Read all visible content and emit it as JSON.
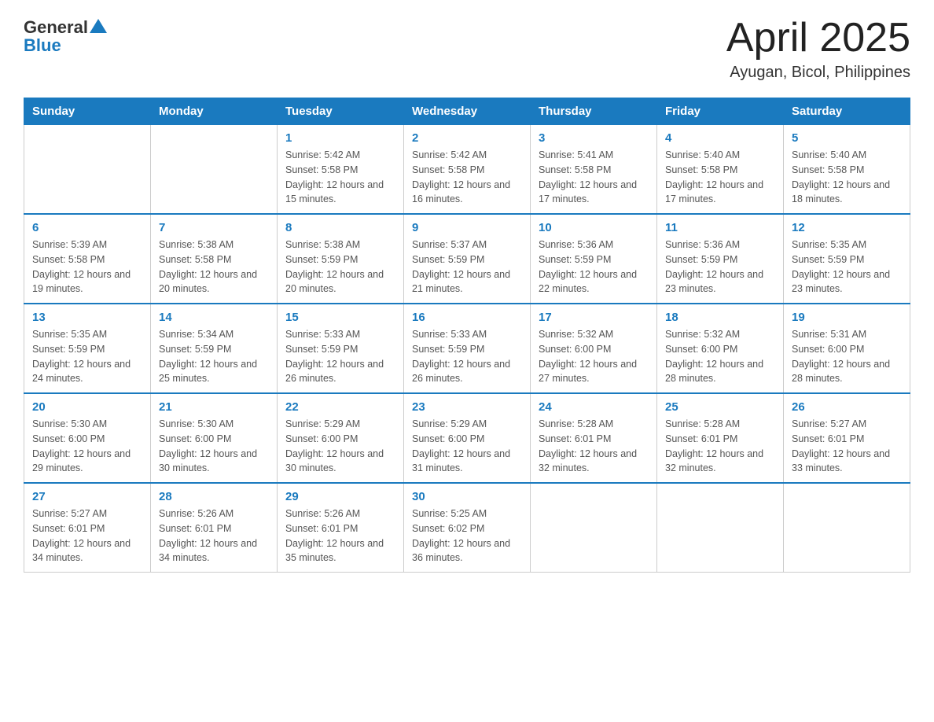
{
  "header": {
    "logo_general": "General",
    "logo_blue": "Blue",
    "month": "April 2025",
    "location": "Ayugan, Bicol, Philippines"
  },
  "weekdays": [
    "Sunday",
    "Monday",
    "Tuesday",
    "Wednesday",
    "Thursday",
    "Friday",
    "Saturday"
  ],
  "weeks": [
    [
      {
        "day": "",
        "sunrise": "",
        "sunset": "",
        "daylight": ""
      },
      {
        "day": "",
        "sunrise": "",
        "sunset": "",
        "daylight": ""
      },
      {
        "day": "1",
        "sunrise": "Sunrise: 5:42 AM",
        "sunset": "Sunset: 5:58 PM",
        "daylight": "Daylight: 12 hours and 15 minutes."
      },
      {
        "day": "2",
        "sunrise": "Sunrise: 5:42 AM",
        "sunset": "Sunset: 5:58 PM",
        "daylight": "Daylight: 12 hours and 16 minutes."
      },
      {
        "day": "3",
        "sunrise": "Sunrise: 5:41 AM",
        "sunset": "Sunset: 5:58 PM",
        "daylight": "Daylight: 12 hours and 17 minutes."
      },
      {
        "day": "4",
        "sunrise": "Sunrise: 5:40 AM",
        "sunset": "Sunset: 5:58 PM",
        "daylight": "Daylight: 12 hours and 17 minutes."
      },
      {
        "day": "5",
        "sunrise": "Sunrise: 5:40 AM",
        "sunset": "Sunset: 5:58 PM",
        "daylight": "Daylight: 12 hours and 18 minutes."
      }
    ],
    [
      {
        "day": "6",
        "sunrise": "Sunrise: 5:39 AM",
        "sunset": "Sunset: 5:58 PM",
        "daylight": "Daylight: 12 hours and 19 minutes."
      },
      {
        "day": "7",
        "sunrise": "Sunrise: 5:38 AM",
        "sunset": "Sunset: 5:58 PM",
        "daylight": "Daylight: 12 hours and 20 minutes."
      },
      {
        "day": "8",
        "sunrise": "Sunrise: 5:38 AM",
        "sunset": "Sunset: 5:59 PM",
        "daylight": "Daylight: 12 hours and 20 minutes."
      },
      {
        "day": "9",
        "sunrise": "Sunrise: 5:37 AM",
        "sunset": "Sunset: 5:59 PM",
        "daylight": "Daylight: 12 hours and 21 minutes."
      },
      {
        "day": "10",
        "sunrise": "Sunrise: 5:36 AM",
        "sunset": "Sunset: 5:59 PM",
        "daylight": "Daylight: 12 hours and 22 minutes."
      },
      {
        "day": "11",
        "sunrise": "Sunrise: 5:36 AM",
        "sunset": "Sunset: 5:59 PM",
        "daylight": "Daylight: 12 hours and 23 minutes."
      },
      {
        "day": "12",
        "sunrise": "Sunrise: 5:35 AM",
        "sunset": "Sunset: 5:59 PM",
        "daylight": "Daylight: 12 hours and 23 minutes."
      }
    ],
    [
      {
        "day": "13",
        "sunrise": "Sunrise: 5:35 AM",
        "sunset": "Sunset: 5:59 PM",
        "daylight": "Daylight: 12 hours and 24 minutes."
      },
      {
        "day": "14",
        "sunrise": "Sunrise: 5:34 AM",
        "sunset": "Sunset: 5:59 PM",
        "daylight": "Daylight: 12 hours and 25 minutes."
      },
      {
        "day": "15",
        "sunrise": "Sunrise: 5:33 AM",
        "sunset": "Sunset: 5:59 PM",
        "daylight": "Daylight: 12 hours and 26 minutes."
      },
      {
        "day": "16",
        "sunrise": "Sunrise: 5:33 AM",
        "sunset": "Sunset: 5:59 PM",
        "daylight": "Daylight: 12 hours and 26 minutes."
      },
      {
        "day": "17",
        "sunrise": "Sunrise: 5:32 AM",
        "sunset": "Sunset: 6:00 PM",
        "daylight": "Daylight: 12 hours and 27 minutes."
      },
      {
        "day": "18",
        "sunrise": "Sunrise: 5:32 AM",
        "sunset": "Sunset: 6:00 PM",
        "daylight": "Daylight: 12 hours and 28 minutes."
      },
      {
        "day": "19",
        "sunrise": "Sunrise: 5:31 AM",
        "sunset": "Sunset: 6:00 PM",
        "daylight": "Daylight: 12 hours and 28 minutes."
      }
    ],
    [
      {
        "day": "20",
        "sunrise": "Sunrise: 5:30 AM",
        "sunset": "Sunset: 6:00 PM",
        "daylight": "Daylight: 12 hours and 29 minutes."
      },
      {
        "day": "21",
        "sunrise": "Sunrise: 5:30 AM",
        "sunset": "Sunset: 6:00 PM",
        "daylight": "Daylight: 12 hours and 30 minutes."
      },
      {
        "day": "22",
        "sunrise": "Sunrise: 5:29 AM",
        "sunset": "Sunset: 6:00 PM",
        "daylight": "Daylight: 12 hours and 30 minutes."
      },
      {
        "day": "23",
        "sunrise": "Sunrise: 5:29 AM",
        "sunset": "Sunset: 6:00 PM",
        "daylight": "Daylight: 12 hours and 31 minutes."
      },
      {
        "day": "24",
        "sunrise": "Sunrise: 5:28 AM",
        "sunset": "Sunset: 6:01 PM",
        "daylight": "Daylight: 12 hours and 32 minutes."
      },
      {
        "day": "25",
        "sunrise": "Sunrise: 5:28 AM",
        "sunset": "Sunset: 6:01 PM",
        "daylight": "Daylight: 12 hours and 32 minutes."
      },
      {
        "day": "26",
        "sunrise": "Sunrise: 5:27 AM",
        "sunset": "Sunset: 6:01 PM",
        "daylight": "Daylight: 12 hours and 33 minutes."
      }
    ],
    [
      {
        "day": "27",
        "sunrise": "Sunrise: 5:27 AM",
        "sunset": "Sunset: 6:01 PM",
        "daylight": "Daylight: 12 hours and 34 minutes."
      },
      {
        "day": "28",
        "sunrise": "Sunrise: 5:26 AM",
        "sunset": "Sunset: 6:01 PM",
        "daylight": "Daylight: 12 hours and 34 minutes."
      },
      {
        "day": "29",
        "sunrise": "Sunrise: 5:26 AM",
        "sunset": "Sunset: 6:01 PM",
        "daylight": "Daylight: 12 hours and 35 minutes."
      },
      {
        "day": "30",
        "sunrise": "Sunrise: 5:25 AM",
        "sunset": "Sunset: 6:02 PM",
        "daylight": "Daylight: 12 hours and 36 minutes."
      },
      {
        "day": "",
        "sunrise": "",
        "sunset": "",
        "daylight": ""
      },
      {
        "day": "",
        "sunrise": "",
        "sunset": "",
        "daylight": ""
      },
      {
        "day": "",
        "sunrise": "",
        "sunset": "",
        "daylight": ""
      }
    ]
  ]
}
